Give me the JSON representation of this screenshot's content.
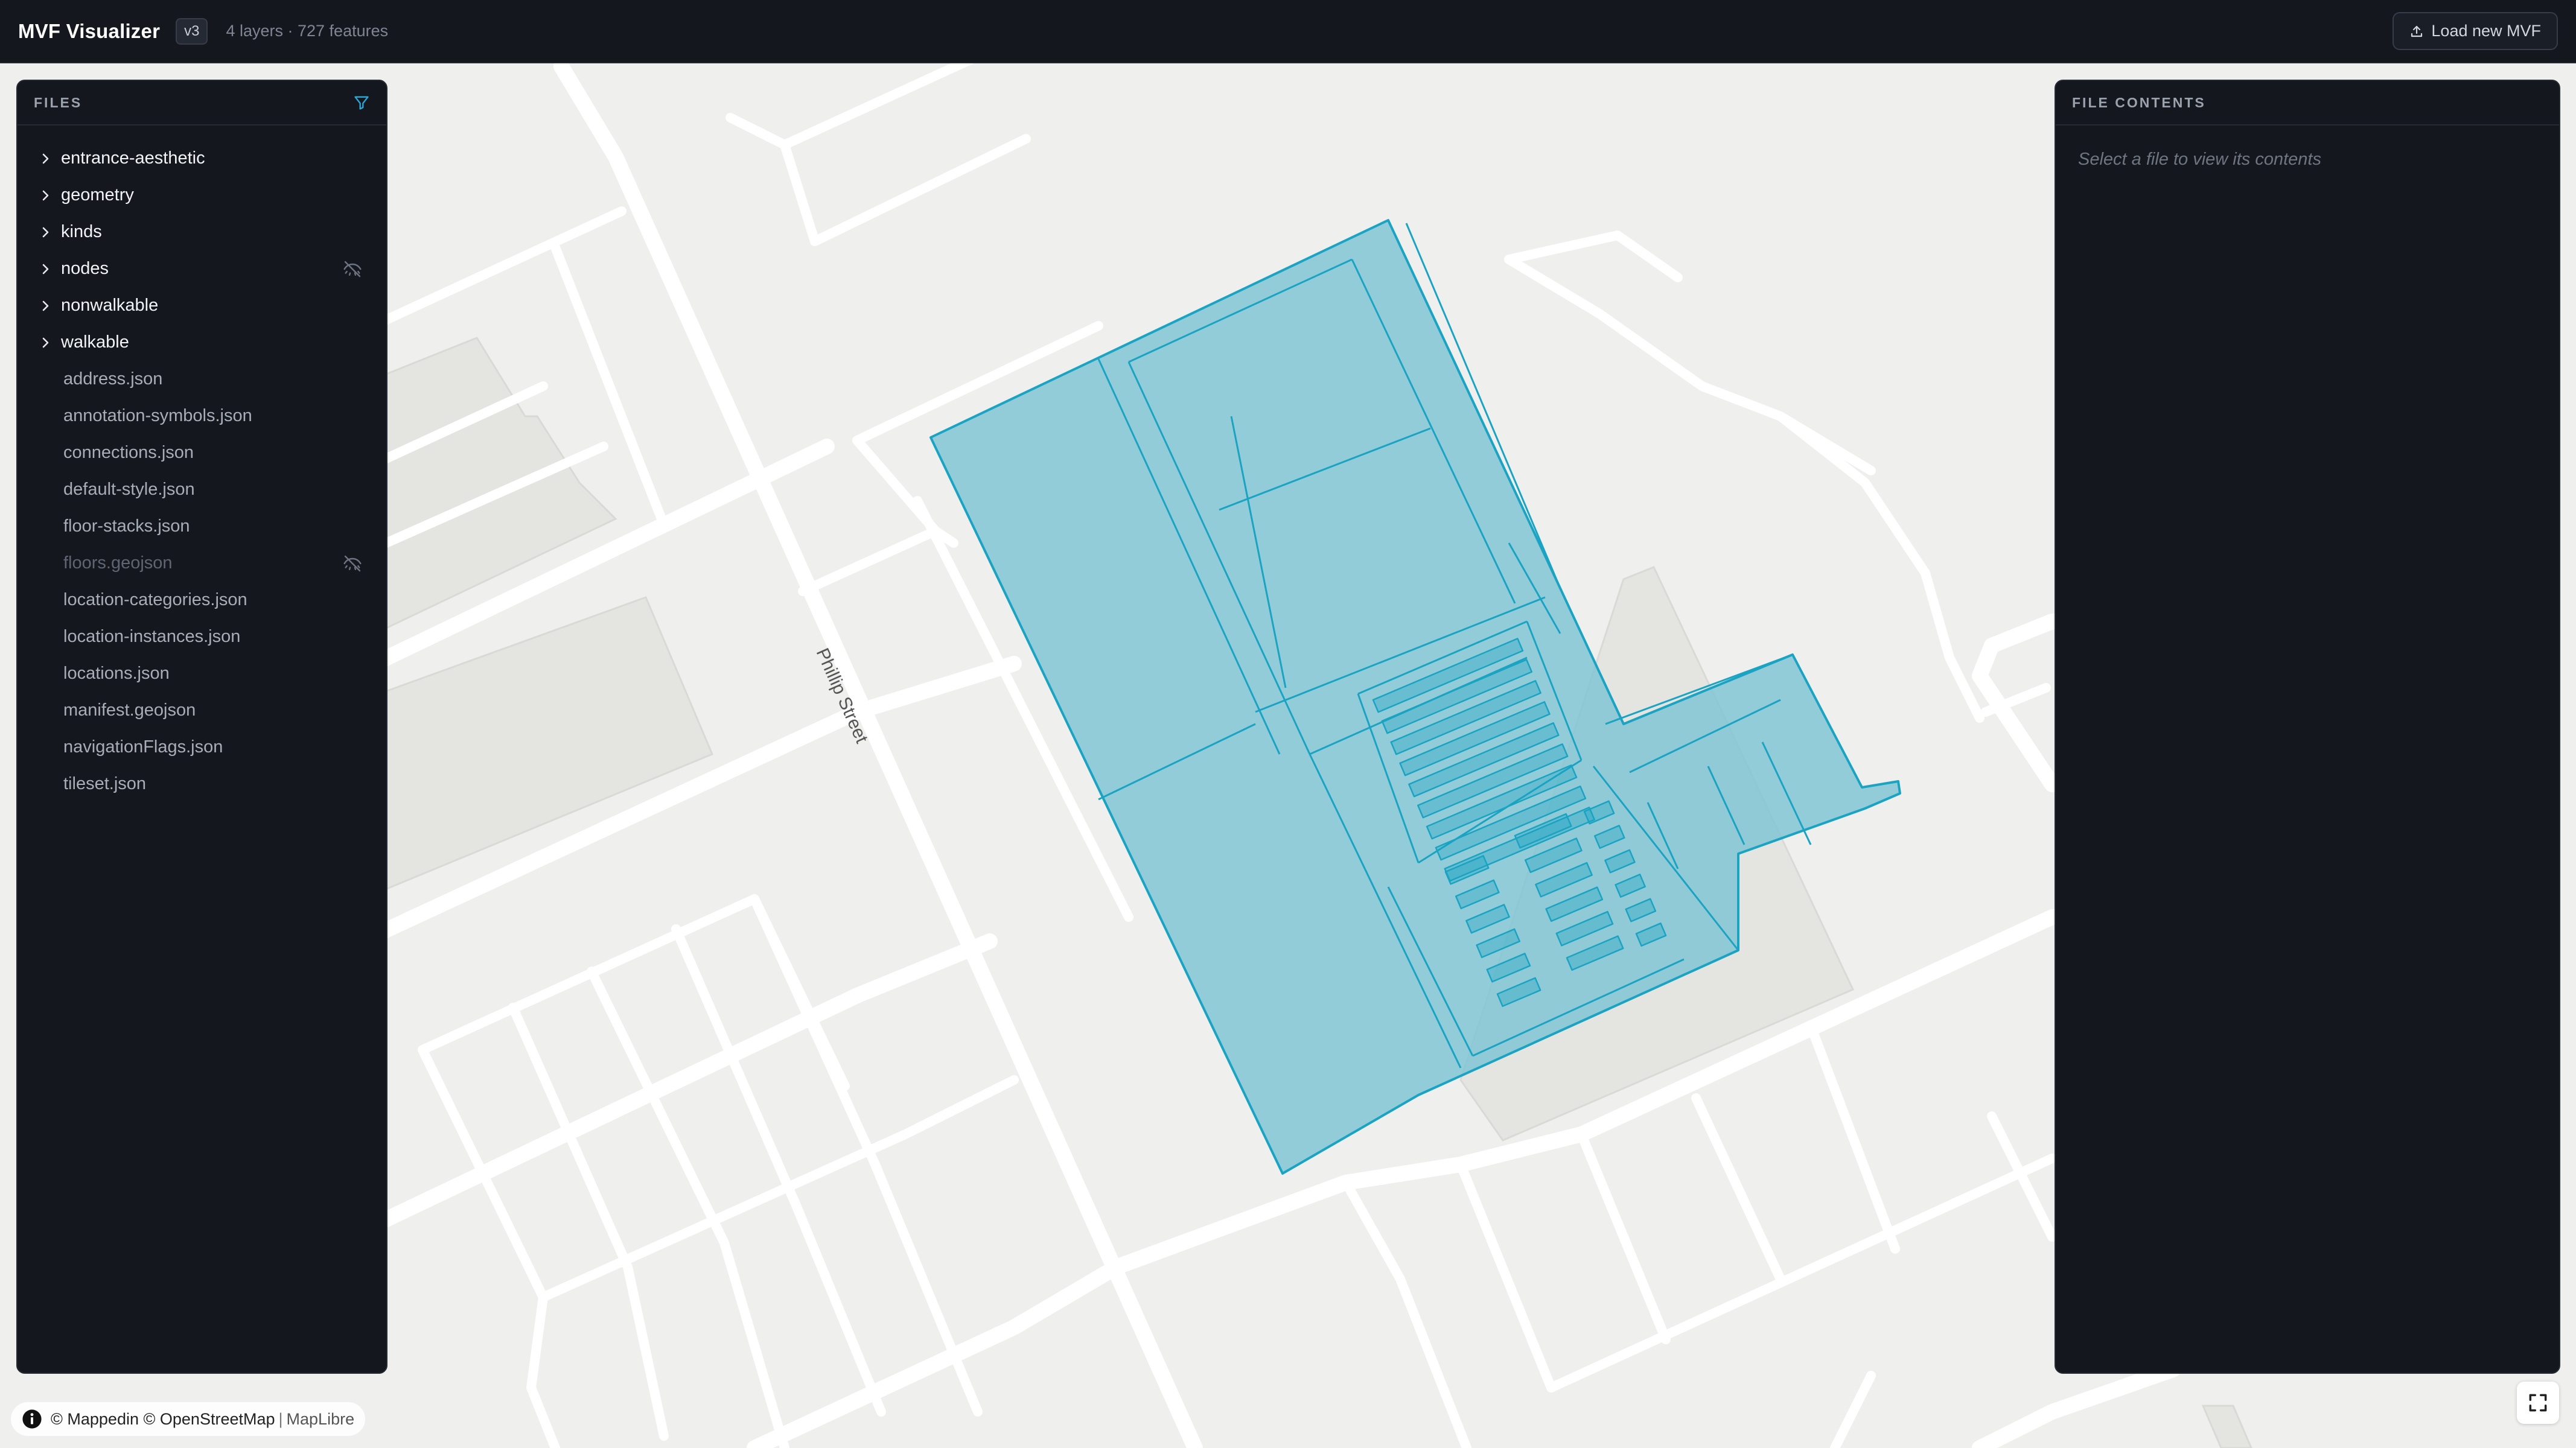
{
  "app": {
    "title": "MVF Visualizer",
    "version": "v3",
    "stats": "4 layers · 727 features",
    "load_button_label": "Load new MVF",
    "load_icon": "upload-icon"
  },
  "files_panel": {
    "header": "FILES",
    "filter_icon": "filter-icon",
    "folders": [
      {
        "label": "entrance-aesthetic"
      },
      {
        "label": "geometry"
      },
      {
        "label": "kinds"
      },
      {
        "label": "nodes",
        "hidden": true
      },
      {
        "label": "nonwalkable"
      },
      {
        "label": "walkable"
      }
    ],
    "files": [
      {
        "label": "address.json"
      },
      {
        "label": "annotation-symbols.json"
      },
      {
        "label": "connections.json"
      },
      {
        "label": "default-style.json"
      },
      {
        "label": "floor-stacks.json"
      },
      {
        "label": "floors.geojson",
        "hidden": true
      },
      {
        "label": "location-categories.json"
      },
      {
        "label": "location-instances.json"
      },
      {
        "label": "locations.json"
      },
      {
        "label": "manifest.geojson"
      },
      {
        "label": "navigationFlags.json"
      },
      {
        "label": "tileset.json"
      }
    ]
  },
  "contents_panel": {
    "header": "FILE CONTENTS",
    "placeholder": "Select a file to view its contents"
  },
  "map": {
    "street_name": "Phillip Street",
    "attribution": {
      "mappedin": "© Mappedin",
      "osm": "© OpenStreetMap",
      "separator": "|",
      "maplibre": "MapLibre"
    },
    "colors": {
      "building_fill": "#7ec5d3",
      "building_stroke": "#1aa3c2",
      "road": "#ffffff",
      "ground": "#efefee",
      "block": "#e4e4e1"
    }
  }
}
